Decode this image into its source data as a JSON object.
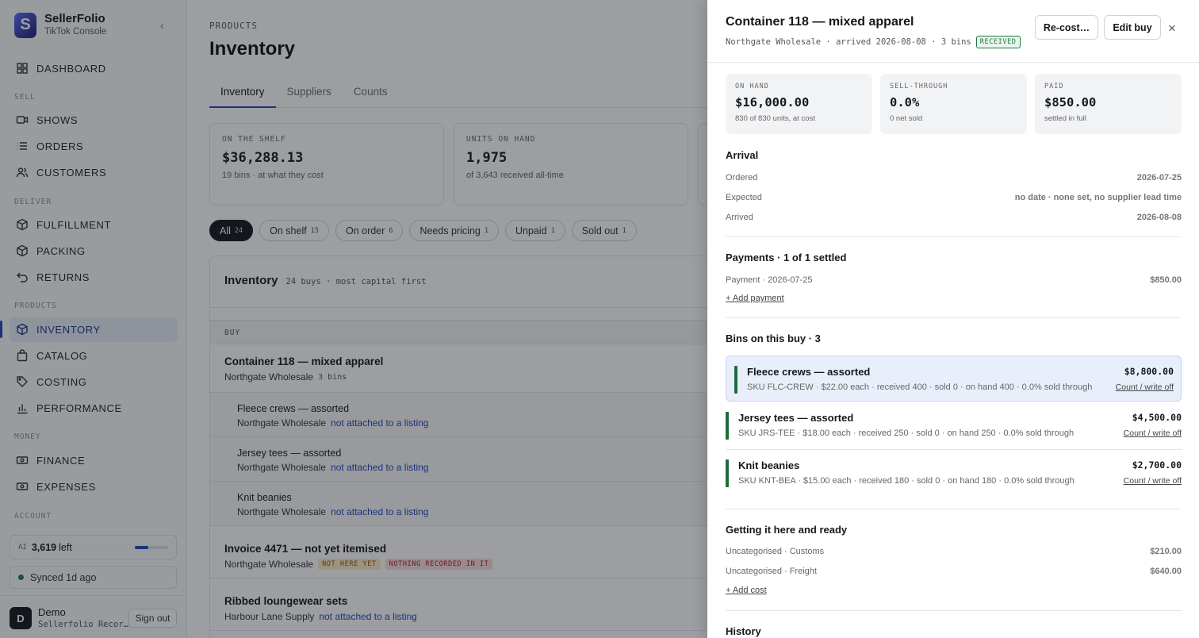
{
  "sidebar": {
    "brand_name": "SellerFolio",
    "brand_sub": "TikTok Console",
    "logo_letter": "S",
    "collapse_glyph": "‹",
    "sections": {
      "sell": "SELL",
      "deliver": "DELIVER",
      "products": "PRODUCTS",
      "money": "MONEY",
      "account": "ACCOUNT"
    },
    "items": {
      "dashboard": "DASHBOARD",
      "shows": "SHOWS",
      "orders": "ORDERS",
      "customers": "CUSTOMERS",
      "fulfillment": "FULFILLMENT",
      "packing": "PACKING",
      "returns": "RETURNS",
      "inventory": "INVENTORY",
      "catalog": "CATALOG",
      "costing": "COSTING",
      "performance": "PERFORMANCE",
      "finance": "FINANCE",
      "expenses": "EXPENSES"
    },
    "ai": {
      "tag": "AI",
      "value": "3,619",
      "suffix": "left",
      "usage_fraction": 0.4
    },
    "sync": "Synced 1d ago",
    "user": {
      "initial": "D",
      "name": "Demo",
      "org": "Sellerfolio Recor…",
      "signout": "Sign out"
    }
  },
  "main": {
    "breadcrumb": "PRODUCTS",
    "title": "Inventory",
    "tabs": [
      "Inventory",
      "Suppliers",
      "Counts"
    ],
    "stats": [
      {
        "label": "ON THE SHELF",
        "value": "$36,288.13",
        "sub": "19 bins · at what they cost"
      },
      {
        "label": "UNITS ON HAND",
        "value": "1,975",
        "sub": "of 3,643 received all-time"
      }
    ],
    "chips": [
      {
        "label": "All",
        "count": "24"
      },
      {
        "label": "On shelf",
        "count": "15"
      },
      {
        "label": "On order",
        "count": "6"
      },
      {
        "label": "Needs pricing",
        "count": "1"
      },
      {
        "label": "Unpaid",
        "count": "1"
      },
      {
        "label": "Sold out",
        "count": "1"
      }
    ],
    "panel": {
      "title": "Inventory",
      "sub": "24 buys · most capital first",
      "col_buy": "BUY"
    },
    "rows": {
      "r1": {
        "title": "Container 118 — mixed apparel",
        "supplier": "Northgate Wholesale",
        "bins": "3 bins"
      },
      "c1": {
        "title": "Fleece crews — assorted",
        "supplier": "Northgate Wholesale",
        "link": "not attached to a listing"
      },
      "c2": {
        "title": "Jersey tees — assorted",
        "supplier": "Northgate Wholesale",
        "link": "not attached to a listing"
      },
      "c3": {
        "title": "Knit beanies",
        "supplier": "Northgate Wholesale",
        "link": "not attached to a listing"
      },
      "r2": {
        "title": "Invoice 4471 — not yet itemised",
        "supplier": "Northgate Wholesale",
        "tag1": "NOT HERE YET",
        "tag2": "NOTHING RECORDED IN IT"
      },
      "r3": {
        "title": "Ribbed loungewear sets",
        "supplier": "Harbour Lane Supply",
        "link": "not attached to a listing"
      }
    }
  },
  "drawer": {
    "title": "Container 118 — mixed apparel",
    "meta": "Northgate Wholesale · arrived 2026-08-08 · 3 bins",
    "status": "RECEIVED",
    "btn_recost": "Re-cost…",
    "btn_edit": "Edit buy",
    "close": "×",
    "kpis": [
      {
        "label": "ON HAND",
        "value": "$16,000.00",
        "sub": "830 of 830 units, at cost"
      },
      {
        "label": "SELL-THROUGH",
        "value": "0.0%",
        "sub": "0 net sold"
      },
      {
        "label": "PAID",
        "value": "$850.00",
        "sub": "settled in full"
      }
    ],
    "arrival": {
      "title": "Arrival",
      "rows": [
        {
          "k": "Ordered",
          "v": "2026-07-25"
        },
        {
          "k": "Expected",
          "v": "no date · none set, no supplier lead time"
        },
        {
          "k": "Arrived",
          "v": "2026-08-08"
        }
      ]
    },
    "payments": {
      "title": "Payments · 1 of 1 settled",
      "rows": [
        {
          "k": "Payment · 2026-07-25",
          "v": "$850.00"
        }
      ],
      "add": "+ Add payment"
    },
    "bins": {
      "title": "Bins on this buy · 3",
      "items": [
        {
          "name": "Fleece crews — assorted",
          "detail": "SKU FLC-CREW · $22.00 each · received 400 · sold 0 · on hand 400 · 0.0% sold through",
          "amount": "$8,800.00",
          "link": "Count / write off"
        },
        {
          "name": "Jersey tees — assorted",
          "detail": "SKU JRS-TEE · $18.00 each · received 250 · sold 0 · on hand 250 · 0.0% sold through",
          "amount": "$4,500.00",
          "link": "Count / write off"
        },
        {
          "name": "Knit beanies",
          "detail": "SKU KNT-BEA · $15.00 each · received 180 · sold 0 · on hand 180 · 0.0% sold through",
          "amount": "$2,700.00",
          "link": "Count / write off"
        }
      ]
    },
    "costs": {
      "title": "Getting it here and ready",
      "rows": [
        {
          "k": "Uncategorised · Customs",
          "v": "$210.00"
        },
        {
          "k": "Uncategorised · Freight",
          "v": "$640.00"
        }
      ],
      "add": "+ Add cost"
    },
    "history_title": "History"
  },
  "colors": {
    "accent": "#2048c0",
    "bin_bar": "#1f6b3d",
    "received": "#1f7a43"
  }
}
